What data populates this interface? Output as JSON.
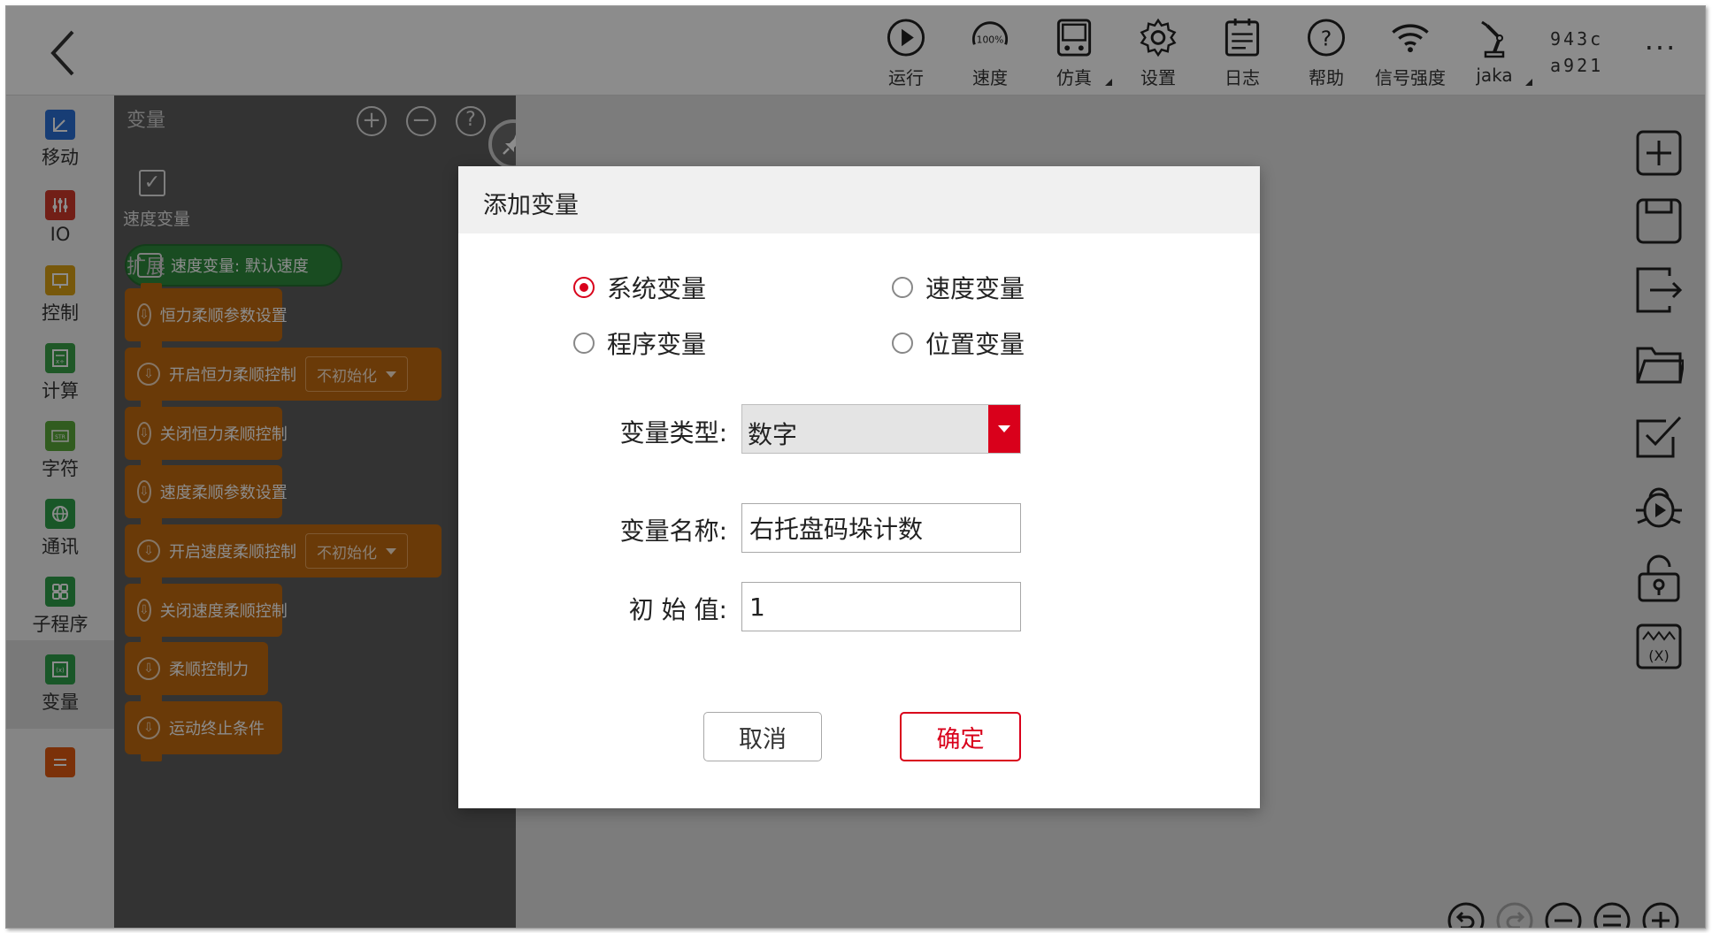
{
  "topbar": {
    "tools": [
      {
        "label": "运行",
        "icon": "play-icon"
      },
      {
        "label": "速度",
        "icon": "speed-gauge-icon",
        "badge": "100%"
      },
      {
        "label": "仿真",
        "icon": "simulation-icon"
      },
      {
        "label": "设置",
        "icon": "gear-icon"
      },
      {
        "label": "日志",
        "icon": "log-icon"
      },
      {
        "label": "帮助",
        "icon": "help-icon"
      },
      {
        "label": "信号强度",
        "icon": "wifi-icon"
      },
      {
        "label": "jaka",
        "icon": "robot-arm-icon"
      }
    ],
    "device_id_line1": "943c",
    "device_id_line2": "a921",
    "more": "···"
  },
  "categories": [
    {
      "label": "移动",
      "color": "#2b6fd6"
    },
    {
      "label": "IO",
      "color": "#d03a2b"
    },
    {
      "label": "控制",
      "color": "#d9a014"
    },
    {
      "label": "计算",
      "color": "#3aa048"
    },
    {
      "label": "字符",
      "color": "#5aa83a"
    },
    {
      "label": "通讯",
      "color": "#2e9e4a"
    },
    {
      "label": "子程序",
      "color": "#2e9e4a"
    },
    {
      "label": "变量",
      "color": "#2e9e4a"
    },
    {
      "label": "",
      "color": "#e05a12"
    }
  ],
  "flyout": {
    "title": "变量",
    "checkbox_label": "速度变量",
    "speed_block": "速度变量: 默认速度",
    "section_extension": "扩展",
    "blocks": [
      {
        "text": "恒力柔顺参数设置",
        "dropdown": ""
      },
      {
        "text": "开启恒力柔顺控制",
        "dropdown": "不初始化"
      },
      {
        "text": "关闭恒力柔顺控制",
        "dropdown": ""
      },
      {
        "text": "速度柔顺参数设置",
        "dropdown": ""
      },
      {
        "text": "开启速度柔顺控制",
        "dropdown": "不初始化"
      },
      {
        "text": "关闭速度柔顺控制",
        "dropdown": ""
      },
      {
        "text": "柔顺控制力",
        "dropdown": ""
      },
      {
        "text": "运动终止条件",
        "dropdown": ""
      }
    ]
  },
  "dialog": {
    "title": "添加变量",
    "radios": [
      {
        "label": "系统变量",
        "checked": true
      },
      {
        "label": "速度变量",
        "checked": false
      },
      {
        "label": "程序变量",
        "checked": false
      },
      {
        "label": "位置变量",
        "checked": false
      }
    ],
    "type_label": "变量类型:",
    "type_value": "数字",
    "name_label": "变量名称:",
    "name_value": "右托盘码垛计数",
    "init_label": "初 始 值:",
    "init_value": "1",
    "cancel_label": "取消",
    "ok_label": "确定"
  },
  "colors": {
    "accent": "#d9001b",
    "block_orange": "#c26a0f",
    "block_green": "#2e8b3d"
  }
}
